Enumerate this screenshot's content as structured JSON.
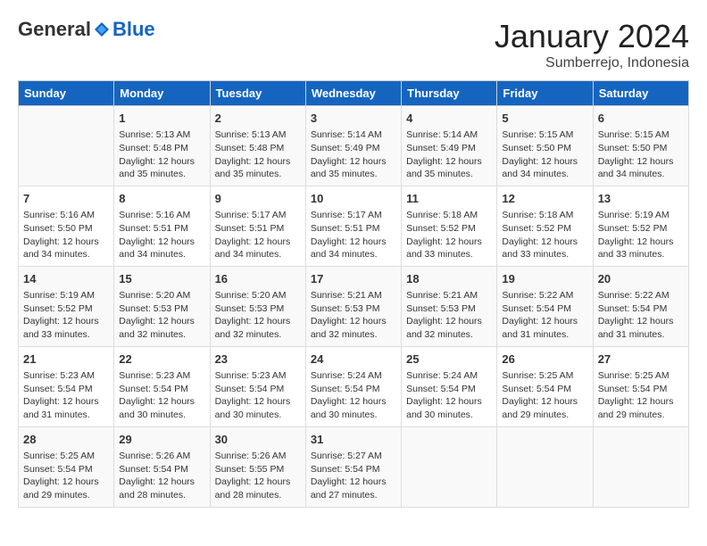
{
  "header": {
    "logo_general": "General",
    "logo_blue": "Blue",
    "month": "January 2024",
    "location": "Sumberrejo, Indonesia"
  },
  "days_of_week": [
    "Sunday",
    "Monday",
    "Tuesday",
    "Wednesday",
    "Thursday",
    "Friday",
    "Saturday"
  ],
  "weeks": [
    [
      {
        "day": "",
        "info": ""
      },
      {
        "day": "1",
        "info": "Sunrise: 5:13 AM\nSunset: 5:48 PM\nDaylight: 12 hours\nand 35 minutes."
      },
      {
        "day": "2",
        "info": "Sunrise: 5:13 AM\nSunset: 5:48 PM\nDaylight: 12 hours\nand 35 minutes."
      },
      {
        "day": "3",
        "info": "Sunrise: 5:14 AM\nSunset: 5:49 PM\nDaylight: 12 hours\nand 35 minutes."
      },
      {
        "day": "4",
        "info": "Sunrise: 5:14 AM\nSunset: 5:49 PM\nDaylight: 12 hours\nand 35 minutes."
      },
      {
        "day": "5",
        "info": "Sunrise: 5:15 AM\nSunset: 5:50 PM\nDaylight: 12 hours\nand 34 minutes."
      },
      {
        "day": "6",
        "info": "Sunrise: 5:15 AM\nSunset: 5:50 PM\nDaylight: 12 hours\nand 34 minutes."
      }
    ],
    [
      {
        "day": "7",
        "info": "Sunrise: 5:16 AM\nSunset: 5:50 PM\nDaylight: 12 hours\nand 34 minutes."
      },
      {
        "day": "8",
        "info": "Sunrise: 5:16 AM\nSunset: 5:51 PM\nDaylight: 12 hours\nand 34 minutes."
      },
      {
        "day": "9",
        "info": "Sunrise: 5:17 AM\nSunset: 5:51 PM\nDaylight: 12 hours\nand 34 minutes."
      },
      {
        "day": "10",
        "info": "Sunrise: 5:17 AM\nSunset: 5:51 PM\nDaylight: 12 hours\nand 34 minutes."
      },
      {
        "day": "11",
        "info": "Sunrise: 5:18 AM\nSunset: 5:52 PM\nDaylight: 12 hours\nand 33 minutes."
      },
      {
        "day": "12",
        "info": "Sunrise: 5:18 AM\nSunset: 5:52 PM\nDaylight: 12 hours\nand 33 minutes."
      },
      {
        "day": "13",
        "info": "Sunrise: 5:19 AM\nSunset: 5:52 PM\nDaylight: 12 hours\nand 33 minutes."
      }
    ],
    [
      {
        "day": "14",
        "info": "Sunrise: 5:19 AM\nSunset: 5:52 PM\nDaylight: 12 hours\nand 33 minutes."
      },
      {
        "day": "15",
        "info": "Sunrise: 5:20 AM\nSunset: 5:53 PM\nDaylight: 12 hours\nand 32 minutes."
      },
      {
        "day": "16",
        "info": "Sunrise: 5:20 AM\nSunset: 5:53 PM\nDaylight: 12 hours\nand 32 minutes."
      },
      {
        "day": "17",
        "info": "Sunrise: 5:21 AM\nSunset: 5:53 PM\nDaylight: 12 hours\nand 32 minutes."
      },
      {
        "day": "18",
        "info": "Sunrise: 5:21 AM\nSunset: 5:53 PM\nDaylight: 12 hours\nand 32 minutes."
      },
      {
        "day": "19",
        "info": "Sunrise: 5:22 AM\nSunset: 5:54 PM\nDaylight: 12 hours\nand 31 minutes."
      },
      {
        "day": "20",
        "info": "Sunrise: 5:22 AM\nSunset: 5:54 PM\nDaylight: 12 hours\nand 31 minutes."
      }
    ],
    [
      {
        "day": "21",
        "info": "Sunrise: 5:23 AM\nSunset: 5:54 PM\nDaylight: 12 hours\nand 31 minutes."
      },
      {
        "day": "22",
        "info": "Sunrise: 5:23 AM\nSunset: 5:54 PM\nDaylight: 12 hours\nand 30 minutes."
      },
      {
        "day": "23",
        "info": "Sunrise: 5:23 AM\nSunset: 5:54 PM\nDaylight: 12 hours\nand 30 minutes."
      },
      {
        "day": "24",
        "info": "Sunrise: 5:24 AM\nSunset: 5:54 PM\nDaylight: 12 hours\nand 30 minutes."
      },
      {
        "day": "25",
        "info": "Sunrise: 5:24 AM\nSunset: 5:54 PM\nDaylight: 12 hours\nand 30 minutes."
      },
      {
        "day": "26",
        "info": "Sunrise: 5:25 AM\nSunset: 5:54 PM\nDaylight: 12 hours\nand 29 minutes."
      },
      {
        "day": "27",
        "info": "Sunrise: 5:25 AM\nSunset: 5:54 PM\nDaylight: 12 hours\nand 29 minutes."
      }
    ],
    [
      {
        "day": "28",
        "info": "Sunrise: 5:25 AM\nSunset: 5:54 PM\nDaylight: 12 hours\nand 29 minutes."
      },
      {
        "day": "29",
        "info": "Sunrise: 5:26 AM\nSunset: 5:54 PM\nDaylight: 12 hours\nand 28 minutes."
      },
      {
        "day": "30",
        "info": "Sunrise: 5:26 AM\nSunset: 5:55 PM\nDaylight: 12 hours\nand 28 minutes."
      },
      {
        "day": "31",
        "info": "Sunrise: 5:27 AM\nSunset: 5:54 PM\nDaylight: 12 hours\nand 27 minutes."
      },
      {
        "day": "",
        "info": ""
      },
      {
        "day": "",
        "info": ""
      },
      {
        "day": "",
        "info": ""
      }
    ]
  ]
}
